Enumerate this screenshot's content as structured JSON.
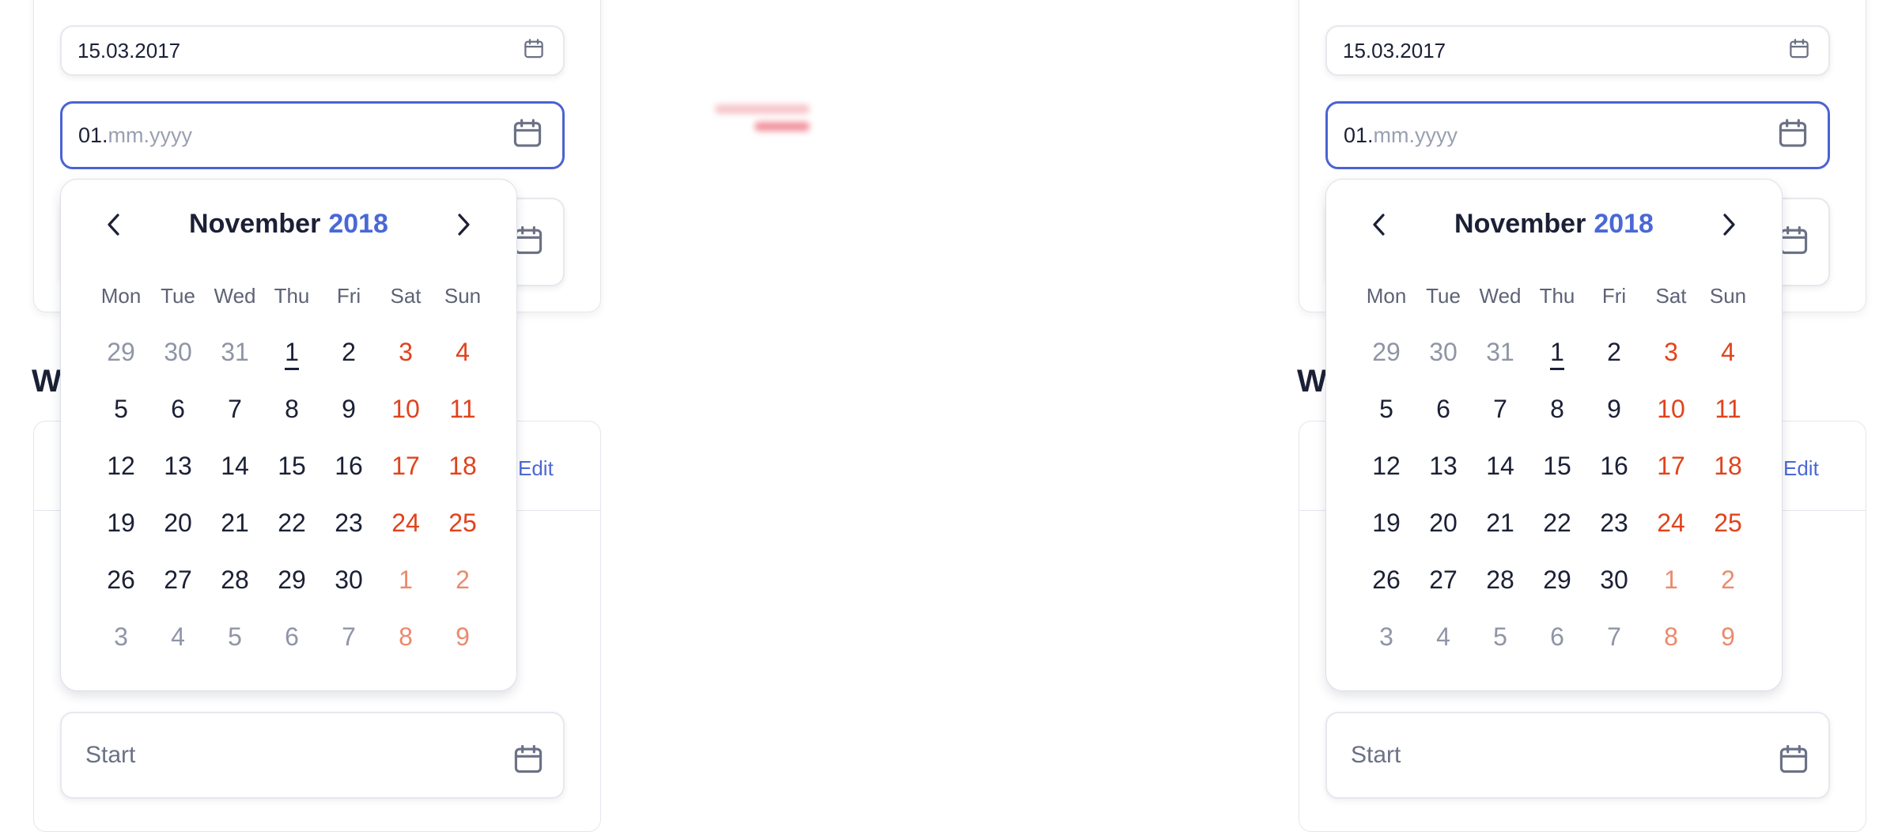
{
  "panels": [
    {
      "date_field_1": {
        "value": "15.03.2017"
      },
      "date_field_2": {
        "typed": "01.",
        "placeholder_rest": "mm.yyyy"
      },
      "section_heading": "W",
      "edit_label": "Edit",
      "start_field": {
        "placeholder": "Start"
      },
      "calendar": {
        "month": "November",
        "year": "2018",
        "weekdays": [
          "Mon",
          "Tue",
          "Wed",
          "Thu",
          "Fri",
          "Sat",
          "Sun"
        ],
        "weeks": [
          [
            "29",
            "30",
            "31",
            "1",
            "2",
            "3",
            "4"
          ],
          [
            "5",
            "6",
            "7",
            "8",
            "9",
            "10",
            "11"
          ],
          [
            "12",
            "13",
            "14",
            "15",
            "16",
            "17",
            "18"
          ],
          [
            "19",
            "20",
            "21",
            "22",
            "23",
            "24",
            "25"
          ],
          [
            "26",
            "27",
            "28",
            "29",
            "30",
            "1",
            "2"
          ],
          [
            "3",
            "4",
            "5",
            "6",
            "7",
            "8",
            "9"
          ]
        ],
        "today": "1"
      }
    },
    {
      "date_field_1": {
        "value": "15.03.2017"
      },
      "date_field_2": {
        "typed": "01.",
        "placeholder_rest": "mm.yyyy"
      },
      "section_heading": "W",
      "edit_label": "Edit",
      "start_field": {
        "placeholder": "Start"
      },
      "calendar": {
        "month": "November",
        "year": "2018",
        "weekdays": [
          "Mon",
          "Tue",
          "Wed",
          "Thu",
          "Fri",
          "Sat",
          "Sun"
        ],
        "weeks": [
          [
            "29",
            "30",
            "31",
            "1",
            "2",
            "3",
            "4"
          ],
          [
            "5",
            "6",
            "7",
            "8",
            "9",
            "10",
            "11"
          ],
          [
            "12",
            "13",
            "14",
            "15",
            "16",
            "17",
            "18"
          ],
          [
            "19",
            "20",
            "21",
            "22",
            "23",
            "24",
            "25"
          ],
          [
            "26",
            "27",
            "28",
            "29",
            "30",
            "1",
            "2"
          ],
          [
            "3",
            "4",
            "5",
            "6",
            "7",
            "8",
            "9"
          ]
        ],
        "today": "1"
      }
    }
  ],
  "colors": {
    "accent": "#4a68d6",
    "active_border": "#4a63d2",
    "weekend": "#e0431c",
    "weekend_muted": "#ec8a6e",
    "text": "#1b2036",
    "muted": "#8f95a6"
  },
  "icons": {
    "date_field": "calendar-icon",
    "prev": "chevron-left-icon",
    "next": "chevron-right-icon"
  }
}
